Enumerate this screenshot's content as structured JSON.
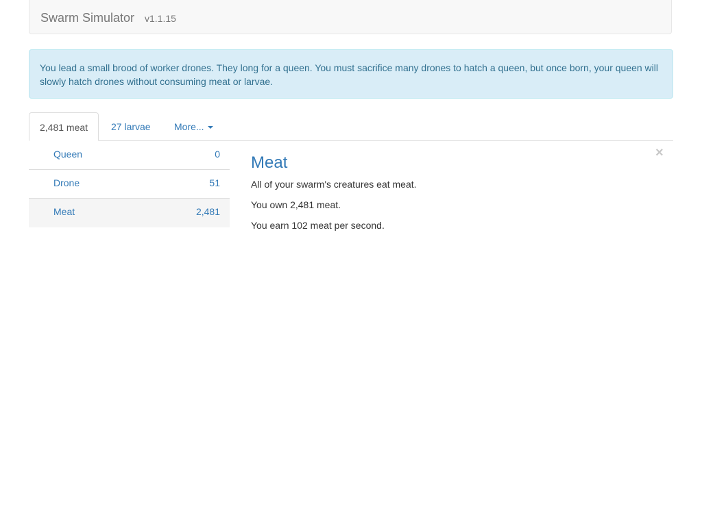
{
  "navbar": {
    "title": "Swarm Simulator",
    "version": "v1.1.15"
  },
  "alert": {
    "text": "You lead a small brood of worker drones. They long for a queen. You must sacrifice many drones to hatch a queen, but once born, your queen will slowly hatch drones without consuming meat or larvae."
  },
  "tabs": [
    {
      "label": "2,481 meat",
      "active": true
    },
    {
      "label": "27 larvae",
      "active": false
    },
    {
      "label": "More...",
      "active": false
    }
  ],
  "units": [
    {
      "name": "Queen",
      "count": "0"
    },
    {
      "name": "Drone",
      "count": "51"
    },
    {
      "name": "Meat",
      "count": "2,481",
      "selected": true
    }
  ],
  "detail": {
    "title": "Meat",
    "lines": [
      "All of your swarm's creatures eat meat.",
      "You own 2,481 meat.",
      "You earn 102 meat per second."
    ],
    "close_glyph": "×"
  },
  "colors": {
    "link": "#337ab7",
    "alert_bg": "#d9edf7",
    "alert_text": "#31708f"
  }
}
